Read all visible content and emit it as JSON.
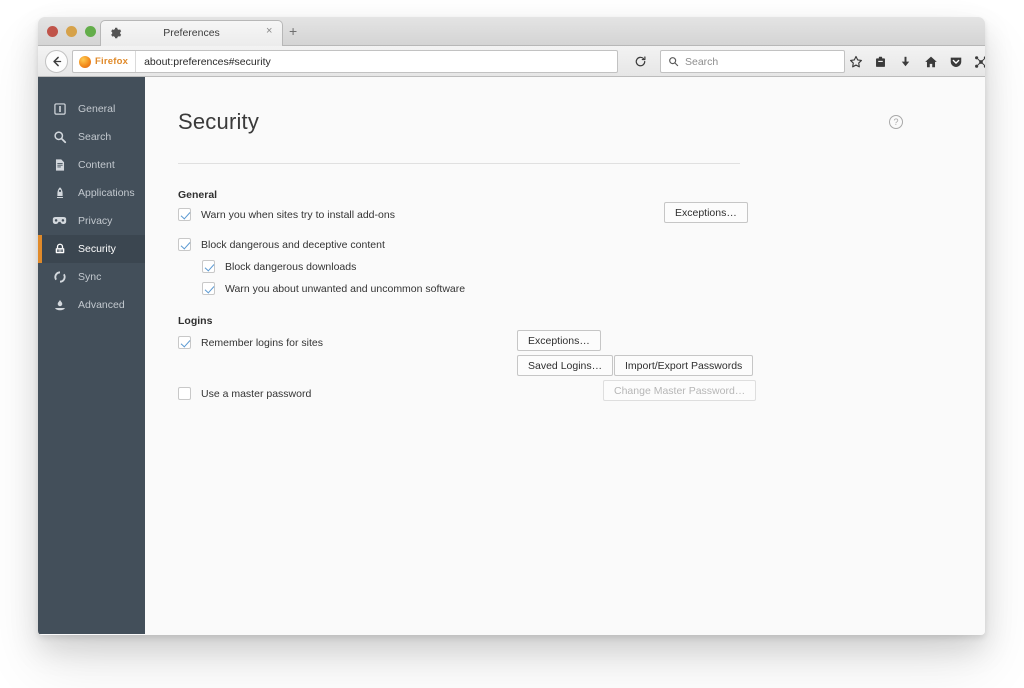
{
  "window": {
    "traffic_lights": [
      "close",
      "minimize",
      "zoom"
    ]
  },
  "tabstrip": {
    "gear_icon": "gear-icon",
    "active_tab_title": "Preferences",
    "close_glyph": "×",
    "new_tab_glyph": "+"
  },
  "navbar": {
    "back_icon": "back-arrow-icon",
    "identity_label": "Firefox",
    "url": "about:preferences#security",
    "reload_glyph": "↻",
    "search_placeholder": "Search",
    "search_icon": "search-icon",
    "icons": [
      {
        "name": "bookmark-star-icon",
        "glyph": "☆"
      },
      {
        "name": "library-icon",
        "glyph": "὜2"
      },
      {
        "name": "downloads-icon",
        "glyph": "⬇"
      },
      {
        "name": "home-icon",
        "glyph": "⌂"
      },
      {
        "name": "pocket-icon",
        "glyph": "▽"
      },
      {
        "name": "sync-tabs-icon",
        "glyph": "✶"
      },
      {
        "name": "hamburger-menu-icon",
        "glyph": "☰"
      }
    ]
  },
  "sidebar": {
    "items": [
      {
        "label": "General",
        "icon": "general-icon",
        "selected": false
      },
      {
        "label": "Search",
        "icon": "search-icon",
        "selected": false
      },
      {
        "label": "Content",
        "icon": "content-icon",
        "selected": false
      },
      {
        "label": "Applications",
        "icon": "applications-icon",
        "selected": false
      },
      {
        "label": "Privacy",
        "icon": "privacy-mask-icon",
        "selected": false
      },
      {
        "label": "Security",
        "icon": "lock-icon",
        "selected": true
      },
      {
        "label": "Sync",
        "icon": "sync-icon",
        "selected": false
      },
      {
        "label": "Advanced",
        "icon": "advanced-icon",
        "selected": false
      }
    ],
    "accent_color": "#e08a2a",
    "background_color": "#434f5a"
  },
  "content": {
    "page_title": "Security",
    "help_icon": "help-question-icon",
    "help_glyph": "?",
    "general": {
      "heading": "General",
      "warn_addons": {
        "label": "Warn you when sites try to install add-ons",
        "checked": true
      },
      "exceptions_button": "Exceptions…",
      "block_content": {
        "label": "Block dangerous and deceptive content",
        "checked": true
      },
      "block_downloads": {
        "label": "Block dangerous downloads",
        "checked": true
      },
      "warn_unwanted": {
        "label": "Warn you about unwanted and uncommon software",
        "checked": true
      }
    },
    "logins": {
      "heading": "Logins",
      "remember_logins": {
        "label": "Remember logins for sites",
        "checked": true
      },
      "exceptions_button": "Exceptions…",
      "saved_logins_button": "Saved Logins…",
      "import_export_button": "Import/Export Passwords",
      "master_password": {
        "label": "Use a master password",
        "checked": false
      },
      "change_master_button": "Change Master Password…",
      "change_master_disabled": true
    }
  }
}
